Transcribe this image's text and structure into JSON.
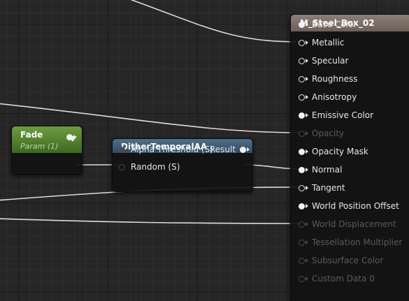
{
  "material_node": {
    "title": "M_Steel_Box_02",
    "pins": [
      {
        "label": "Base Color",
        "state": "connected"
      },
      {
        "label": "Metallic",
        "state": "open"
      },
      {
        "label": "Specular",
        "state": "open"
      },
      {
        "label": "Roughness",
        "state": "open"
      },
      {
        "label": "Anisotropy",
        "state": "open"
      },
      {
        "label": "Emissive Color",
        "state": "connected"
      },
      {
        "label": "Opacity",
        "state": "disabled"
      },
      {
        "label": "Opacity Mask",
        "state": "connected"
      },
      {
        "label": "Normal",
        "state": "connected"
      },
      {
        "label": "Tangent",
        "state": "open"
      },
      {
        "label": "World Position Offset",
        "state": "connected"
      },
      {
        "label": "World Displacement",
        "state": "disabled"
      },
      {
        "label": "Tessellation Multiplier",
        "state": "disabled"
      },
      {
        "label": "Subsurface Color",
        "state": "disabled"
      },
      {
        "label": "Custom Data 0",
        "state": "disabled"
      }
    ]
  },
  "fade_node": {
    "title": "Fade",
    "subtitle": "Param (1)"
  },
  "dither_node": {
    "title": "DitherTemporalAA",
    "inputs": [
      {
        "label": "Alpha Threshold (S)",
        "state": "disabled-filled"
      },
      {
        "label": "Random (S)",
        "state": "disabled"
      }
    ],
    "output": {
      "label": "Result",
      "state": "connected"
    }
  },
  "colors": {
    "canvas_bg": "#262626",
    "material_header": "#7d6f67",
    "param_header": "#5b8a35",
    "function_header": "#40607b",
    "wire": "#e0e0e0"
  }
}
